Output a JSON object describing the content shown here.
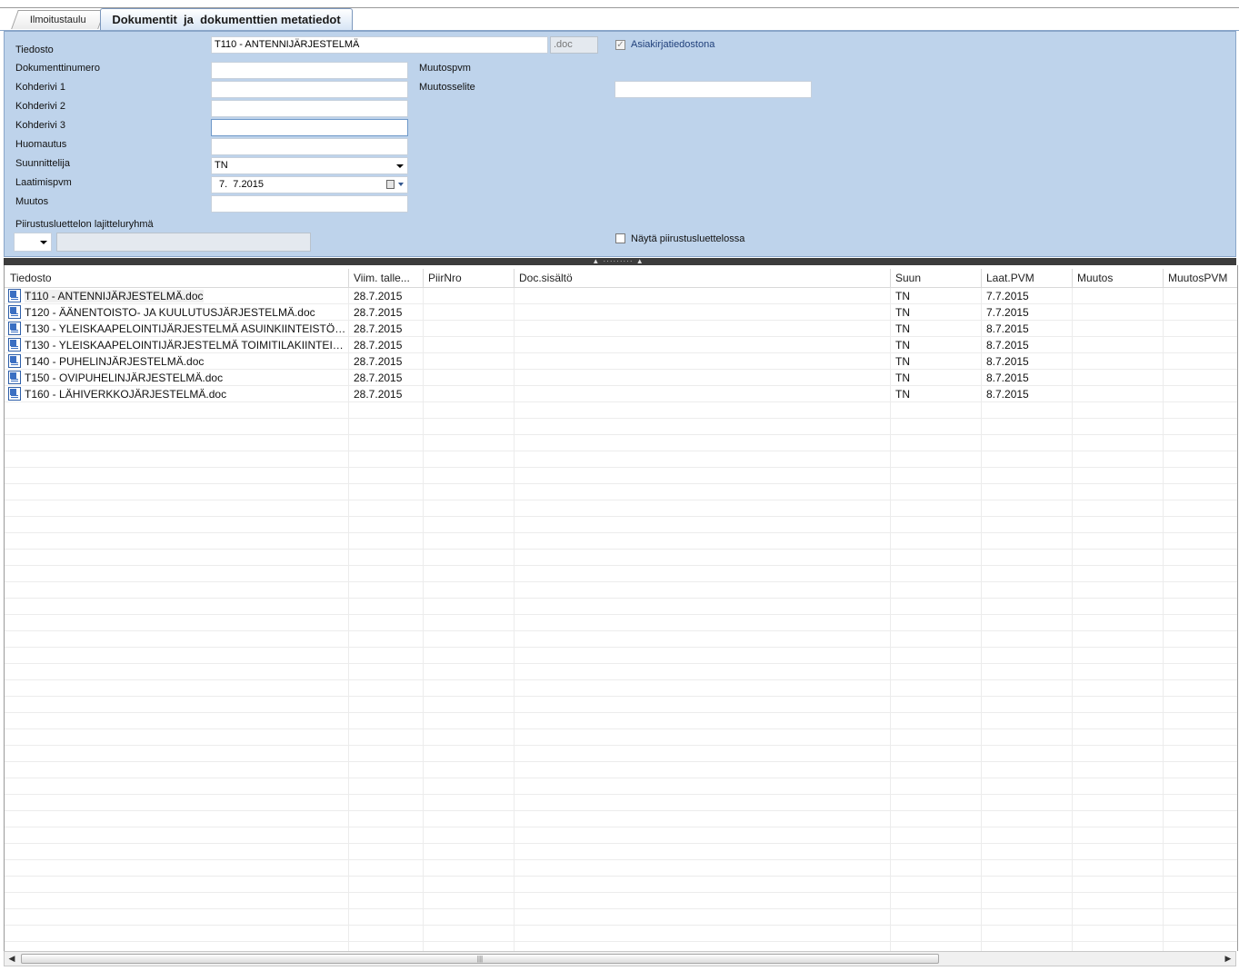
{
  "tabs": [
    {
      "label": "Ilmoitustaulu",
      "active": false
    },
    {
      "label": "Dokumentit  ja  dokumenttien metatiedot",
      "active": true
    }
  ],
  "form": {
    "tiedosto_label": "Tiedosto",
    "tiedosto_value": "T110 - ANTENNIJÄRJESTELMÄ",
    "extension_value": ".doc",
    "asiakirja_label": "Asiakirjatiedostona",
    "asiakirja_checked": true,
    "dokumenttinumero_label": "Dokumenttinumero",
    "dokumenttinumero_value": "",
    "kohderivi1_label": "Kohderivi 1",
    "kohderivi1_value": "",
    "kohderivi2_label": "Kohderivi 2",
    "kohderivi2_value": "",
    "kohderivi3_label": "Kohderivi 3",
    "kohderivi3_value": "",
    "huomautus_label": "Huomautus",
    "huomautus_value": "",
    "suunnittelija_label": "Suunnittelija",
    "suunnittelija_value": "TN",
    "laatimispvm_label": "Laatimispvm",
    "laatimispvm_value": "7.  7.2015",
    "muutos_label": "Muutos",
    "muutos_value": "",
    "muutospvm_label": "Muutospvm",
    "muutosselite_label": "Muutosselite",
    "muutosselite_value": "",
    "lajitteluryhma_label": "Piirustusluettelon lajitteluryhmä",
    "lajitteluryhma_value": "",
    "nayta_label": "Näytä piirustusluettelossa",
    "nayta_checked": false
  },
  "grid": {
    "columns": [
      "Tiedosto",
      "Viim. talle...",
      "PiirNro",
      "Doc.sisältö",
      "Suun",
      "Laat.PVM",
      "Muutos",
      "MuutosPVM"
    ],
    "rows": [
      [
        "T110 - ANTENNIJÄRJESTELMÄ.doc",
        "28.7.2015",
        "",
        "",
        "TN",
        "7.7.2015",
        "",
        ""
      ],
      [
        "T120 - ÄÄNENTOISTO- JA KUULUTUSJÄRJESTELMÄ.doc",
        "28.7.2015",
        "",
        "",
        "TN",
        "7.7.2015",
        "",
        ""
      ],
      [
        "T130 - YLEISKAAPELOINTIJÄRJESTELMÄ ASUINKIINTEISTÖ.d...",
        "28.7.2015",
        "",
        "",
        "TN",
        "8.7.2015",
        "",
        ""
      ],
      [
        "T130 - YLEISKAAPELOINTIJÄRJESTELMÄ TOIMITILAKIINTEIS...",
        "28.7.2015",
        "",
        "",
        "TN",
        "8.7.2015",
        "",
        ""
      ],
      [
        "T140 - PUHELINJÄRJESTELMÄ.doc",
        "28.7.2015",
        "",
        "",
        "TN",
        "8.7.2015",
        "",
        ""
      ],
      [
        "T150 - OVIPUHELINJÄRJESTELMÄ.doc",
        "28.7.2015",
        "",
        "",
        "TN",
        "8.7.2015",
        "",
        ""
      ],
      [
        "T160 - LÄHIVERKKOJÄRJESTELMÄ.doc",
        "28.7.2015",
        "",
        "",
        "TN",
        "8.7.2015",
        "",
        ""
      ]
    ]
  },
  "icons": {
    "file": "word-document-icon",
    "calendar": "calendar-icon",
    "dropdown": "chevron-down-icon"
  },
  "colors": {
    "form_background": "#bed3eb",
    "tab_active_top": "#ffffff",
    "tab_active_bottom": "#d7e5f5",
    "link_text": "#1f3f7a"
  }
}
